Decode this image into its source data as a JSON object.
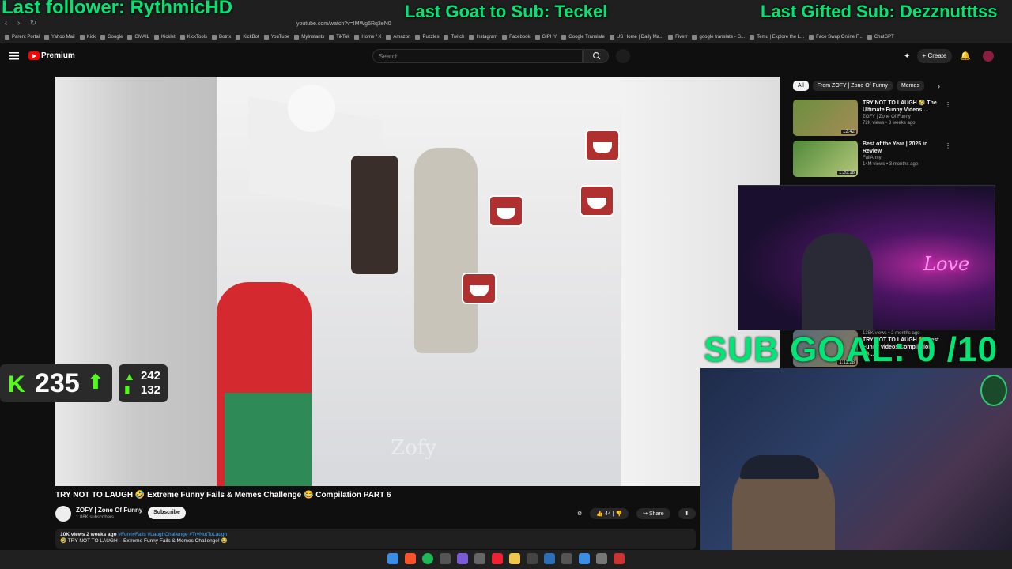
{
  "overlay": {
    "last_follower": "Last follower: RythmicHD",
    "last_goat": "Last Goat to Sub: Teckel",
    "last_gifted": "Last Gifted Sub: Dezznutttss",
    "sub_goal": "SUB GOAL: 0 /10",
    "neon_sign": "Love"
  },
  "browser": {
    "url": "youtube.com/watch?v=IMWg6Rq3eN0",
    "bookmarks": [
      "Parent Portal",
      "Yahoo Mail",
      "Kick",
      "Google",
      "GMAIL",
      "Kicklet",
      "KickTools",
      "Botrix",
      "KickBot",
      "YouTube",
      "MyInstants",
      "TikTok",
      "Home / X",
      "Amazon",
      "Puzzles",
      "Twitch",
      "Instagram",
      "Facebook",
      "GIPHY",
      "Google Translate",
      "US Home | Daily Ma...",
      "Fiverr",
      "google translate - G...",
      "Temu | Explore the L...",
      "Face Swap Online F...",
      "ChatGPT"
    ]
  },
  "header": {
    "brand": "Premium",
    "search_placeholder": "Search",
    "create_label": "Create"
  },
  "video": {
    "title": "TRY NOT TO LAUGH 🤣 Extreme Funny Fails & Memes Challenge 😂 Compilation PART 6",
    "watermark": "Zofy",
    "channel": "ZOFY | Zone Of Funny",
    "subscribers": "1.86K subscribers",
    "subscribe_label": "Subscribe",
    "likes": "44",
    "share_label": "Share",
    "description": {
      "meta": "10K views  2 weeks ago",
      "tags": "#FunnyFails #LaughChallenge #TryNotToLaugh",
      "line2": "🤣 TRY NOT TO LAUGH – Extreme Funny Fails & Memes Challenge! 😂"
    }
  },
  "kick_widget": {
    "viewers": "235",
    "stat_up": "242",
    "stat_down": "132"
  },
  "sidebar": {
    "chips": [
      "All",
      "From ZOFY | Zone Of Funny",
      "Memes"
    ],
    "recommendations": [
      {
        "title": "TRY NOT TO LAUGH 🤣 The Ultimate Funny Videos ...",
        "channel": "ZOFY | Zone Of Funny",
        "meta": "72K views • 3 weeks ago",
        "duration": "12:42"
      },
      {
        "title": "Best of the Year | 2025 in Review",
        "channel": "FailArmy",
        "meta": "14M views • 3 months ago",
        "duration": "1:20:18"
      }
    ],
    "partial_rec": {
      "title": "TRY NOT TO LAUGH 🤣 Best Funny videos Compilation 😂...",
      "meta": "135K views • 2 months ago",
      "duration": "1:11:28"
    }
  },
  "colors": {
    "accent_green": "#00e676",
    "kick_green": "#53fc18",
    "yt_red": "#ff0000"
  }
}
